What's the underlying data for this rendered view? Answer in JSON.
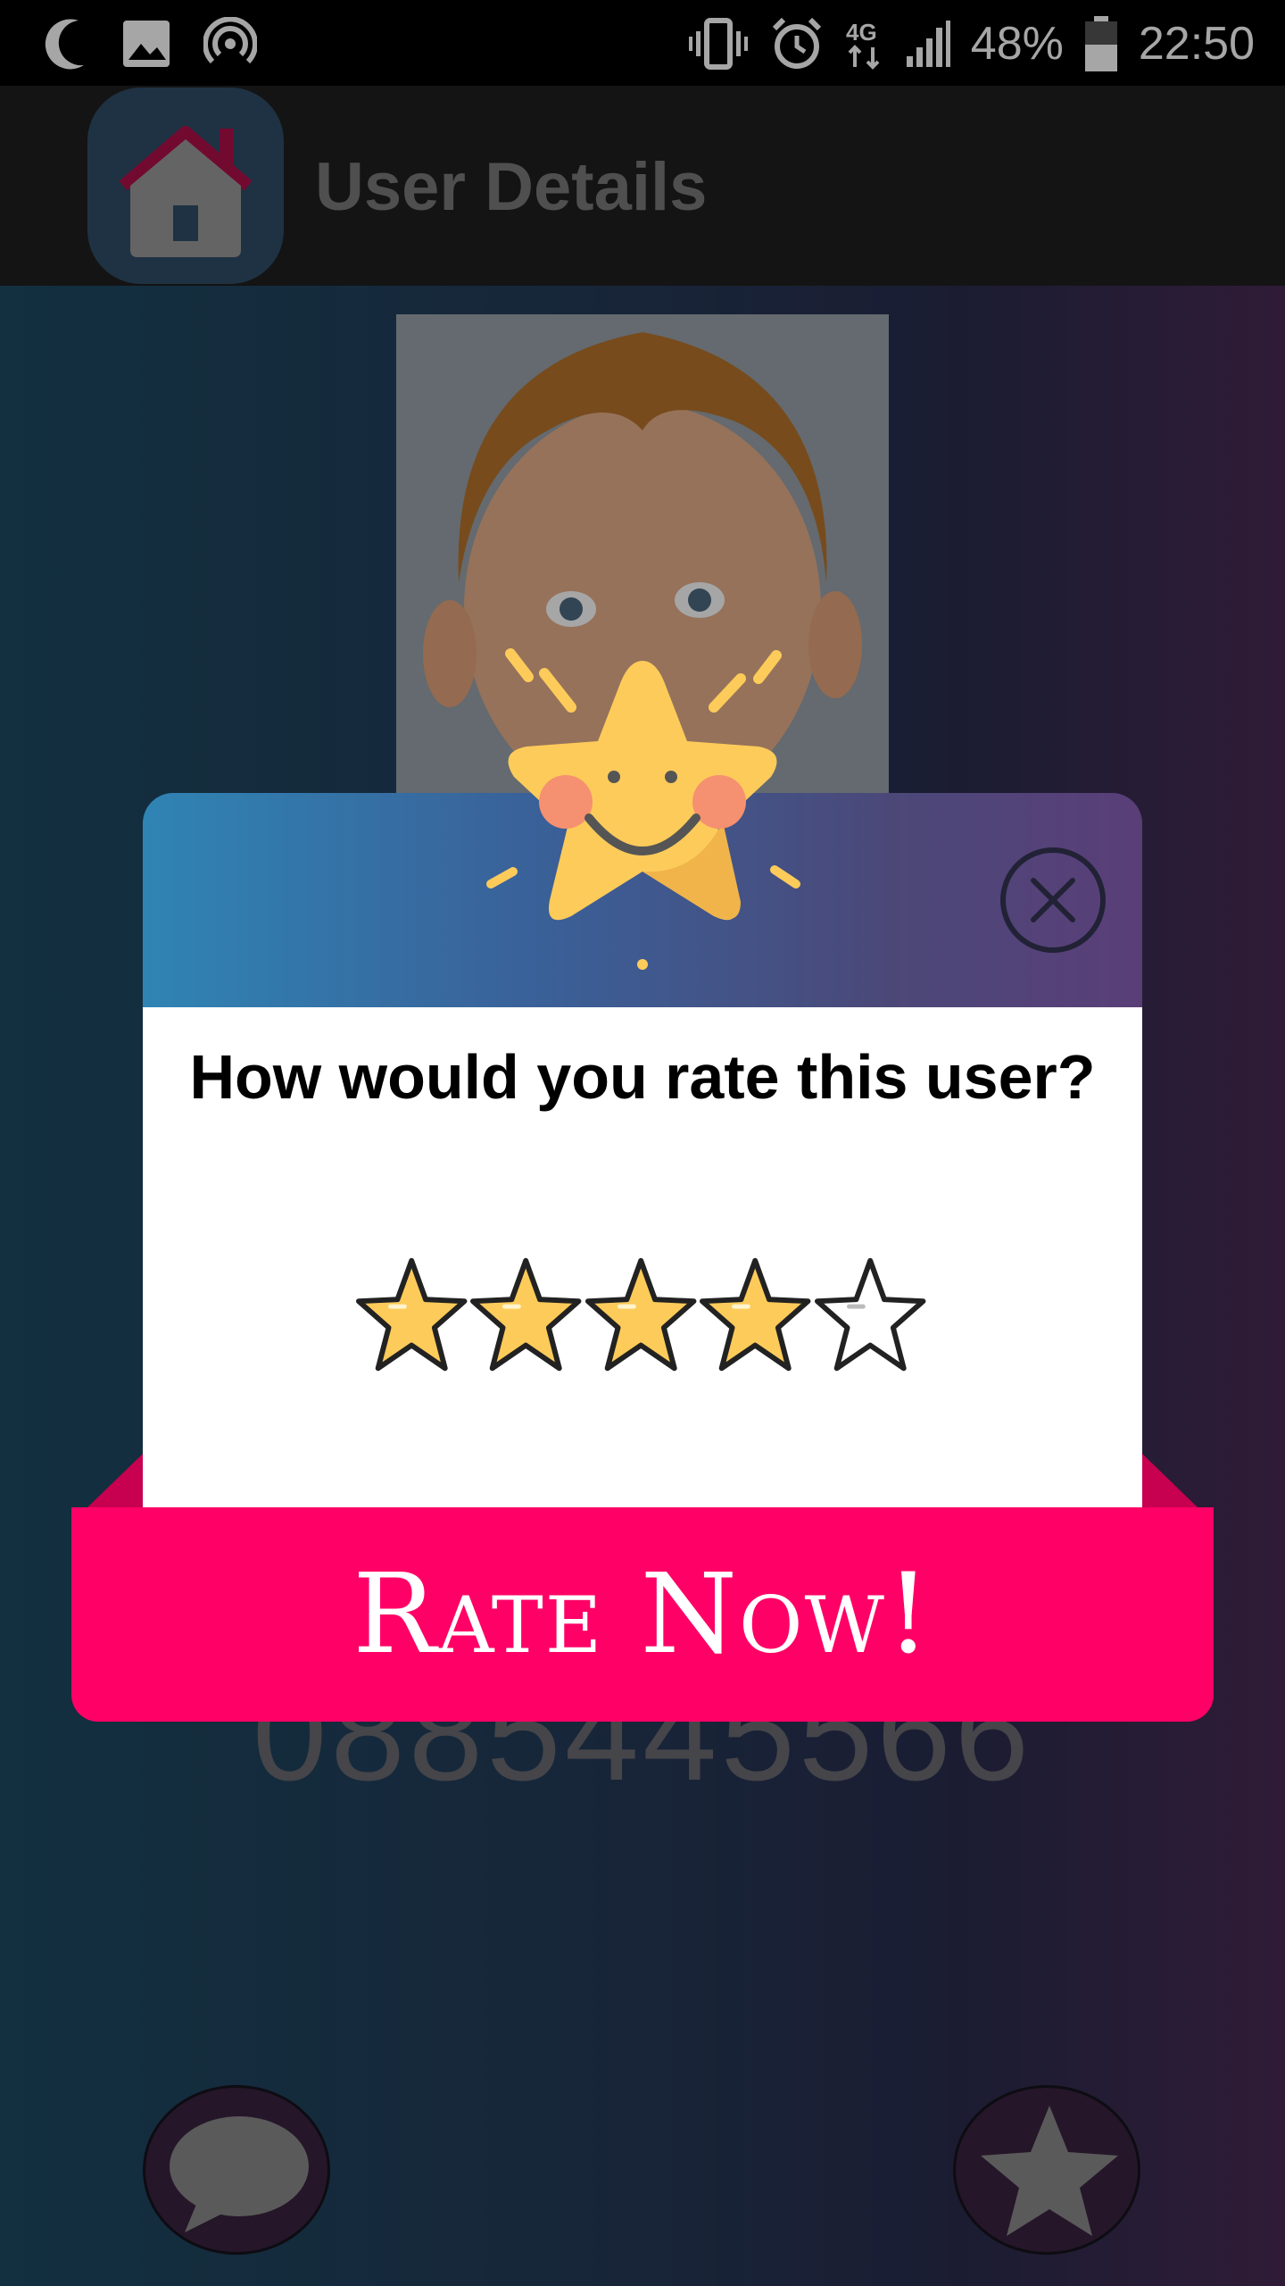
{
  "status_bar": {
    "battery": "48%",
    "time": "22:50",
    "network": "4G",
    "icons": [
      "moon-icon",
      "image-icon",
      "hotspot-icon",
      "vibrate-icon",
      "alarm-icon",
      "network-4g-icon",
      "signal-icon",
      "battery-icon"
    ]
  },
  "app_bar": {
    "title": "User Details",
    "logo_icon": "home-icon"
  },
  "user": {
    "phone": "0885445566"
  },
  "dialog": {
    "question": "How would you rate this user?",
    "rating": 4,
    "max_rating": 5,
    "button_label": "Rate Now!",
    "close_icon": "close-icon",
    "mascot_icon": "smiling-star-icon"
  },
  "actions": {
    "chat_icon": "chat-bubble-icon",
    "favorite_icon": "star-icon"
  },
  "colors": {
    "button": "#ff0066",
    "star_fill": "#fdcb5a",
    "header_gradient_start": "#2f84b4",
    "header_gradient_end": "#5a3e78"
  }
}
